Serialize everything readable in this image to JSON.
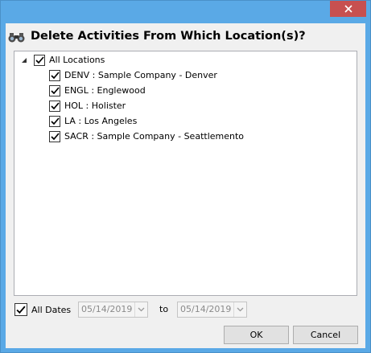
{
  "dialog": {
    "title": "Delete Activities From Which Location(s)?"
  },
  "tree": {
    "root": {
      "label": "All Locations",
      "checked": true,
      "expanded": true
    },
    "items": [
      {
        "label": "DENV : Sample Company - Denver",
        "checked": true
      },
      {
        "label": "ENGL : Englewood",
        "checked": true
      },
      {
        "label": "HOL : Holister",
        "checked": true
      },
      {
        "label": "LA : Los Angeles",
        "checked": true
      },
      {
        "label": "SACR : Sample Company - Seattlemento",
        "checked": true
      }
    ]
  },
  "dates": {
    "all_dates_label": "All Dates",
    "all_dates_checked": true,
    "from": "05/14/2019",
    "to_label": "to",
    "to": "05/14/2019"
  },
  "buttons": {
    "ok": "OK",
    "cancel": "Cancel"
  },
  "colors": {
    "window_frame": "#5aa9e6",
    "close_button": "#c75050",
    "dialog_bg": "#f0f0f0"
  }
}
